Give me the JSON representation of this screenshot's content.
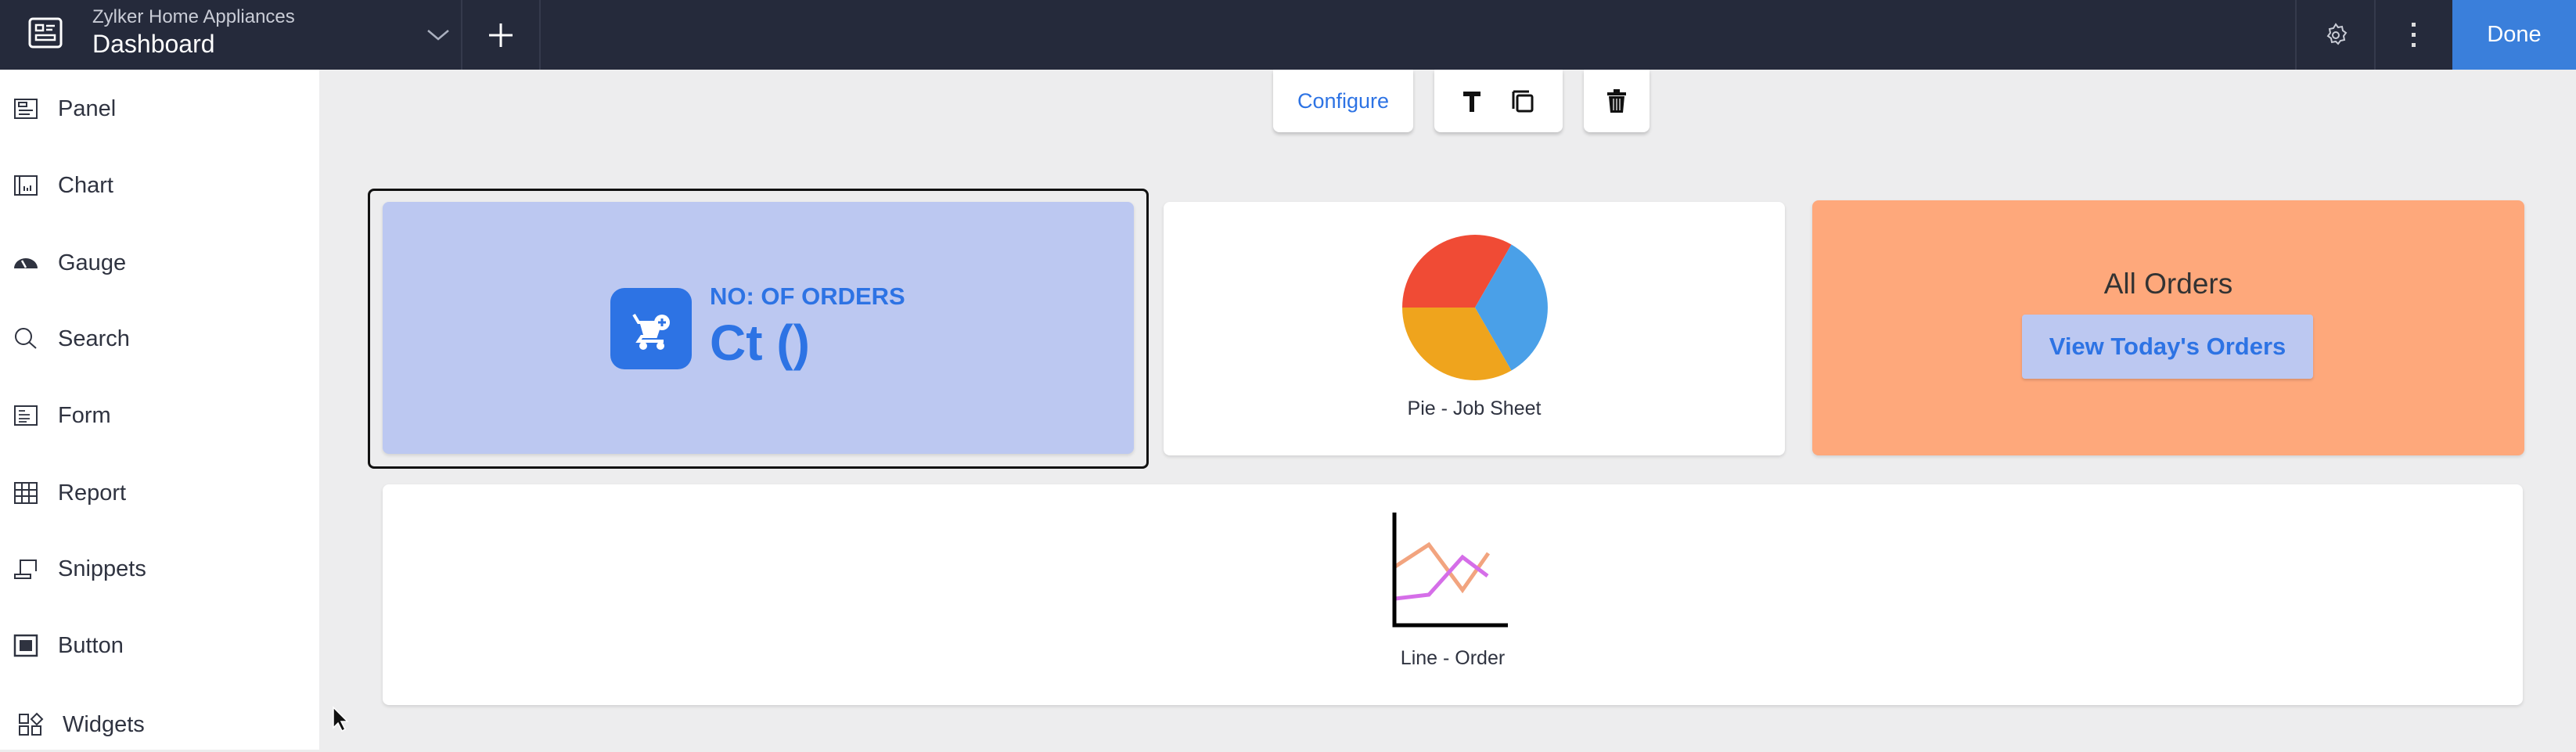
{
  "header": {
    "app_name": "Zylker Home Appliances",
    "page_title": "Dashboard",
    "done_label": "Done"
  },
  "sidebar": {
    "items": [
      {
        "label": "Panel",
        "icon": "panel-icon"
      },
      {
        "label": "Chart",
        "icon": "chart-icon"
      },
      {
        "label": "Gauge",
        "icon": "gauge-icon"
      },
      {
        "label": "Search",
        "icon": "search-icon"
      },
      {
        "label": "Form",
        "icon": "form-icon"
      },
      {
        "label": "Report",
        "icon": "report-icon"
      },
      {
        "label": "Snippets",
        "icon": "snippets-icon"
      },
      {
        "label": "Button",
        "icon": "button-icon"
      },
      {
        "label": "Widgets",
        "icon": "widgets-icon"
      }
    ]
  },
  "toolbar": {
    "configure_label": "Configure"
  },
  "cards": {
    "orders_count": {
      "title": "NO: OF ORDERS",
      "value": "Ct ()",
      "bg": "#bcc8f1",
      "accent": "#2d73e4"
    },
    "pie": {
      "label": "Pie - Job Sheet",
      "colors": [
        "#f04b35",
        "#4aa0e8",
        "#efa41d"
      ]
    },
    "all_orders": {
      "title": "All Orders",
      "button_label": "View Today's Orders",
      "bg": "#fea87b"
    },
    "line": {
      "label": "Line - Order",
      "colors": [
        "#f2a47f",
        "#d56ee8"
      ]
    }
  }
}
